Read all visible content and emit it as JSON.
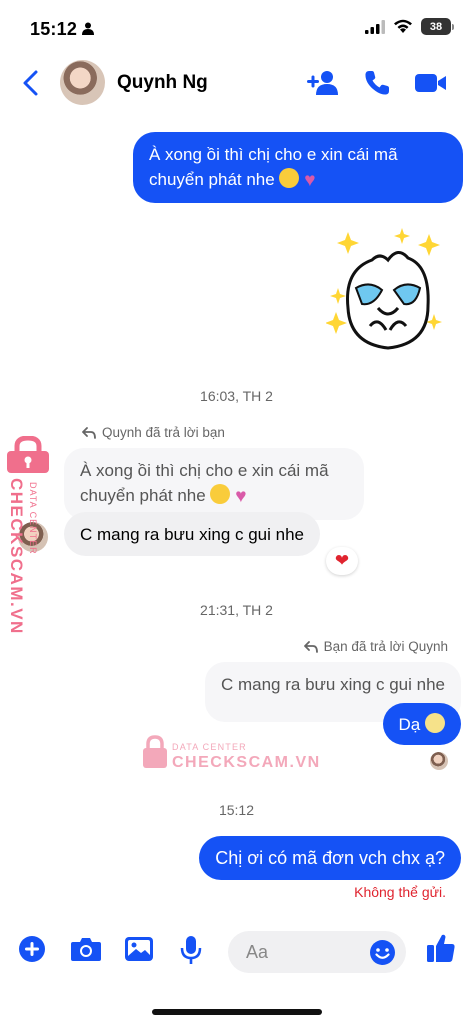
{
  "status_bar": {
    "time": "15:12",
    "battery": "38"
  },
  "header": {
    "contact_name": "Quynh Ng"
  },
  "messages": {
    "partial_timestamp": "",
    "out_msg_1": "À xong ồi thì chị cho e xin cái mã chuyển phát nhe",
    "timestamp_1": "16:03, TH 2",
    "reply_label_1": "Quynh đã trả lời bạn",
    "quoted_1": "À xong ồi thì chị cho e xin cái mã chuyển phát nhe",
    "in_msg_1": "C mang ra bưu xing c gui nhe",
    "reaction_1": "❤",
    "timestamp_2": "21:31, TH 2",
    "reply_label_2": "Bạn đã trả lời Quynh",
    "quoted_2": "C mang ra bưu xing c gui nhe",
    "out_msg_2": "Dạ",
    "timestamp_3": "15:12",
    "out_msg_3": "Chị ơi có mã đơn vch chx ạ?",
    "error": "Không thể gửi."
  },
  "watermark": {
    "vertical_name": "CHECKSCAM.VN",
    "vertical_sub": "DATA CENTER",
    "center_title": "DATA CENTER",
    "center_name": "CHECKSCAM.VN"
  },
  "composer": {
    "placeholder": "Aa"
  },
  "colors": {
    "accent": "#1552f5",
    "error": "#e0242f",
    "watermark": "#f06f8c"
  },
  "icons": [
    "back-icon",
    "add-person-icon",
    "phone-icon",
    "video-icon",
    "plus-icon",
    "camera-icon",
    "image-icon",
    "microphone-icon",
    "emoji-icon",
    "thumbs-up-icon",
    "reply-arrow-icon",
    "lock-icon"
  ]
}
